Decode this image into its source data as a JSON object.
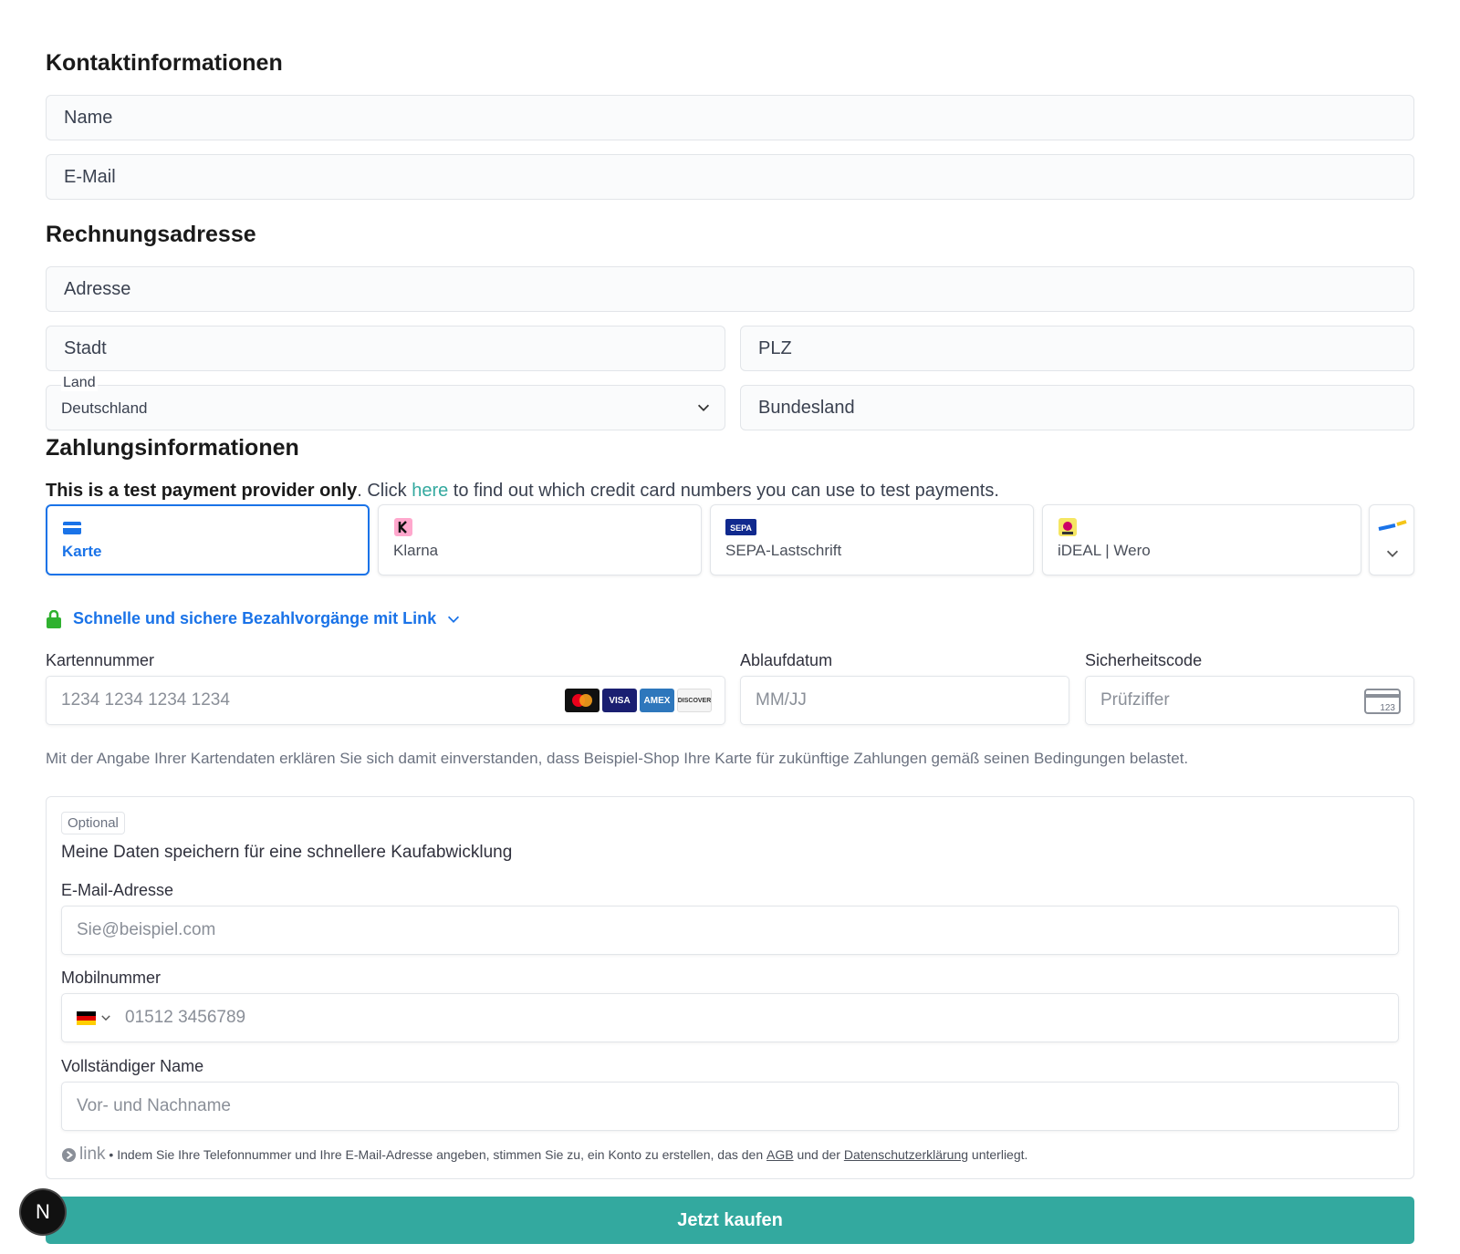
{
  "contact": {
    "heading": "Kontaktinformationen",
    "name_placeholder": "Name",
    "email_placeholder": "E-Mail"
  },
  "billing": {
    "heading": "Rechnungsadresse",
    "address_placeholder": "Adresse",
    "city_placeholder": "Stadt",
    "zip_placeholder": "PLZ",
    "country_label": "Land",
    "country_value": "Deutschland",
    "state_placeholder": "Bundesland"
  },
  "payment": {
    "heading": "Zahlungsinformationen",
    "notice_bold": "This is a test payment provider only",
    "notice_pre": ". Click ",
    "notice_link": "here",
    "notice_post": " to find out which credit card numbers you can use to test payments.",
    "tabs": [
      {
        "label": "Karte",
        "icon": "card-icon",
        "active": true
      },
      {
        "label": "Klarna",
        "icon": "klarna-icon",
        "active": false
      },
      {
        "label": "SEPA-Lastschrift",
        "icon": "sepa-icon",
        "active": false
      },
      {
        "label": "iDEAL | Wero",
        "icon": "ideal-icon",
        "active": false
      }
    ],
    "link_promo": "Schnelle und sichere Bezahlvorgänge mit Link",
    "card_number_label": "Kartennummer",
    "card_number_placeholder": "1234 1234 1234 1234",
    "card_brands": [
      "mastercard",
      "visa",
      "amex",
      "discover"
    ],
    "brand_text": {
      "visa": "VISA",
      "amex": "AMEX",
      "discover": "DISCOVER"
    },
    "expiry_label": "Ablaufdatum",
    "expiry_placeholder": "MM/JJ",
    "cvc_label": "Sicherheitscode",
    "cvc_placeholder": "Prüfziffer",
    "cvc_icon_text": "123",
    "consent": "Mit der Angabe Ihrer Kartendaten erklären Sie sich damit einverstanden, dass Beispiel-Shop Ihre Karte für zukünftige Zahlungen gemäß seinen Bedingungen belastet."
  },
  "save": {
    "optional": "Optional",
    "title": "Meine Daten speichern für eine schnellere Kaufabwicklung",
    "email_label": "E-Mail-Adresse",
    "email_placeholder": "Sie@beispiel.com",
    "phone_label": "Mobilnummer",
    "phone_placeholder": "01512 3456789",
    "fullname_label": "Vollständiger Name",
    "fullname_placeholder": "Vor- und Nachname",
    "legal_brand": "link",
    "legal_sep": " • ",
    "legal_pre": "Indem Sie Ihre Telefonnummer und Ihre E-Mail-Adresse angeben, stimmen Sie zu, ein Konto zu erstellen, das den ",
    "legal_agb": "AGB",
    "legal_mid": " und der ",
    "legal_privacy": "Datenschutzerklärung",
    "legal_post": " unterliegt."
  },
  "buy_button": "Jetzt kaufen",
  "badge_letter": "N",
  "colors": {
    "accent": "#33a99f",
    "active_blue": "#1a73e8"
  }
}
